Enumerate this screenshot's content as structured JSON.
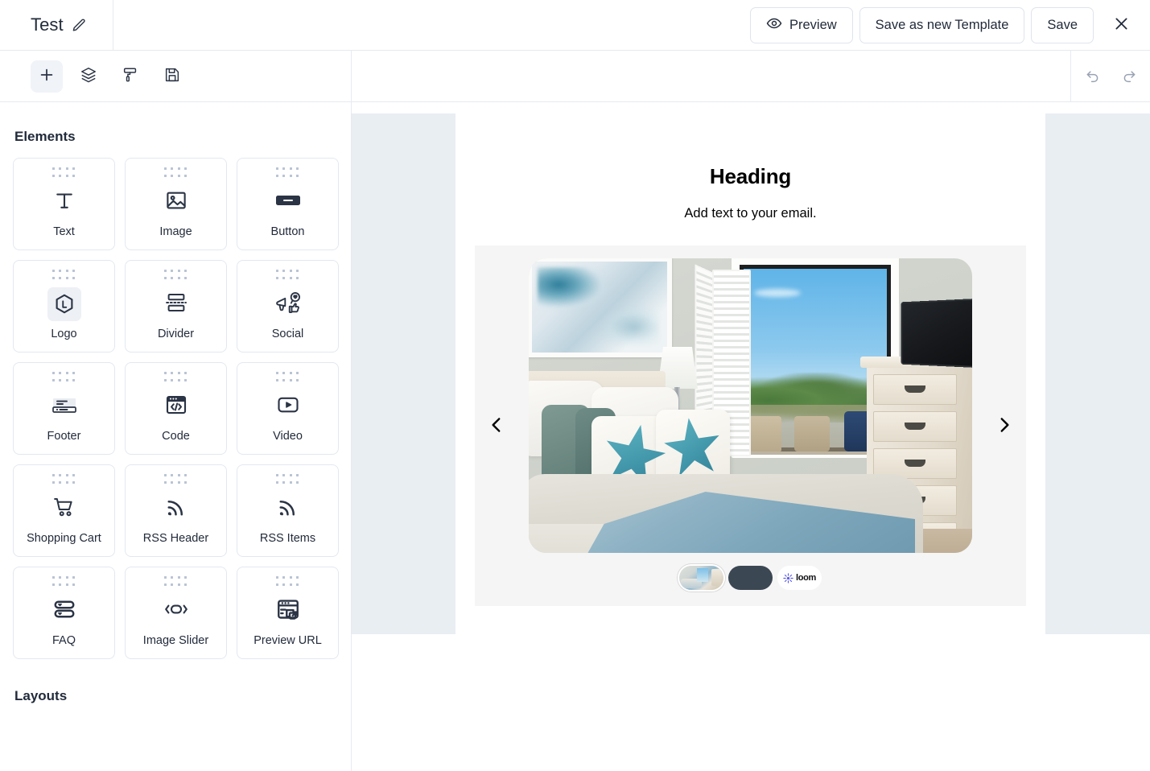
{
  "topbar": {
    "doc_title": "Test",
    "edit_icon": "pencil-icon",
    "preview_label": "Preview",
    "save_template_label": "Save as new Template",
    "save_label": "Save",
    "close_icon": "close-icon"
  },
  "toolbar": {
    "items": [
      {
        "name": "add",
        "icon": "plus-icon",
        "active": true
      },
      {
        "name": "layers",
        "icon": "layers-icon",
        "active": false
      },
      {
        "name": "styles",
        "icon": "paint-roller-icon",
        "active": false
      },
      {
        "name": "save",
        "icon": "floppy-disk-icon",
        "active": false
      }
    ],
    "undo_icon": "undo-icon",
    "redo_icon": "redo-icon"
  },
  "sidebar": {
    "elements_title": "Elements",
    "layouts_title": "Layouts",
    "elements": [
      {
        "label": "Text",
        "icon": "text-icon",
        "boxed": false
      },
      {
        "label": "Image",
        "icon": "image-icon",
        "boxed": false
      },
      {
        "label": "Button",
        "icon": "button-icon",
        "boxed": false
      },
      {
        "label": "Logo",
        "icon": "logo-icon",
        "boxed": true
      },
      {
        "label": "Divider",
        "icon": "divider-icon",
        "boxed": false
      },
      {
        "label": "Social",
        "icon": "social-icon",
        "boxed": false
      },
      {
        "label": "Footer",
        "icon": "footer-icon",
        "boxed": false
      },
      {
        "label": "Code",
        "icon": "code-icon",
        "boxed": false
      },
      {
        "label": "Video",
        "icon": "video-icon",
        "boxed": false
      },
      {
        "label": "Shopping Cart",
        "icon": "shopping-cart-icon",
        "boxed": false
      },
      {
        "label": "RSS Header",
        "icon": "rss-icon",
        "boxed": false
      },
      {
        "label": "RSS Items",
        "icon": "rss-icon",
        "boxed": false
      },
      {
        "label": "FAQ",
        "icon": "faq-icon",
        "boxed": false
      },
      {
        "label": "Image Slider",
        "icon": "image-slider-icon",
        "boxed": false
      },
      {
        "label": "Preview URL",
        "icon": "preview-url-icon",
        "boxed": false
      }
    ]
  },
  "email": {
    "heading": "Heading",
    "subtext": "Add text to your email.",
    "carousel": {
      "prev_icon": "chevron-left-icon",
      "next_icon": "chevron-right-icon",
      "slide_alt": "coastal-bedroom-photo",
      "thumbnails": [
        {
          "name": "thumb-bedroom",
          "type": "photo",
          "selected": true
        },
        {
          "name": "thumb-solid",
          "type": "solid",
          "selected": false
        },
        {
          "name": "thumb-loom",
          "type": "logo",
          "label": "loom",
          "selected": false
        }
      ]
    }
  },
  "colors": {
    "canvas_bg": "#e8eef2",
    "email_bg": "#ffffff",
    "carousel_bg": "#f5f5f5",
    "ink": "#222b3b",
    "border": "#e6eaef",
    "thumb_solid": "#3c4754",
    "loom_purple": "#5c5ce0",
    "active_tool_bg": "#f0f3f7"
  }
}
